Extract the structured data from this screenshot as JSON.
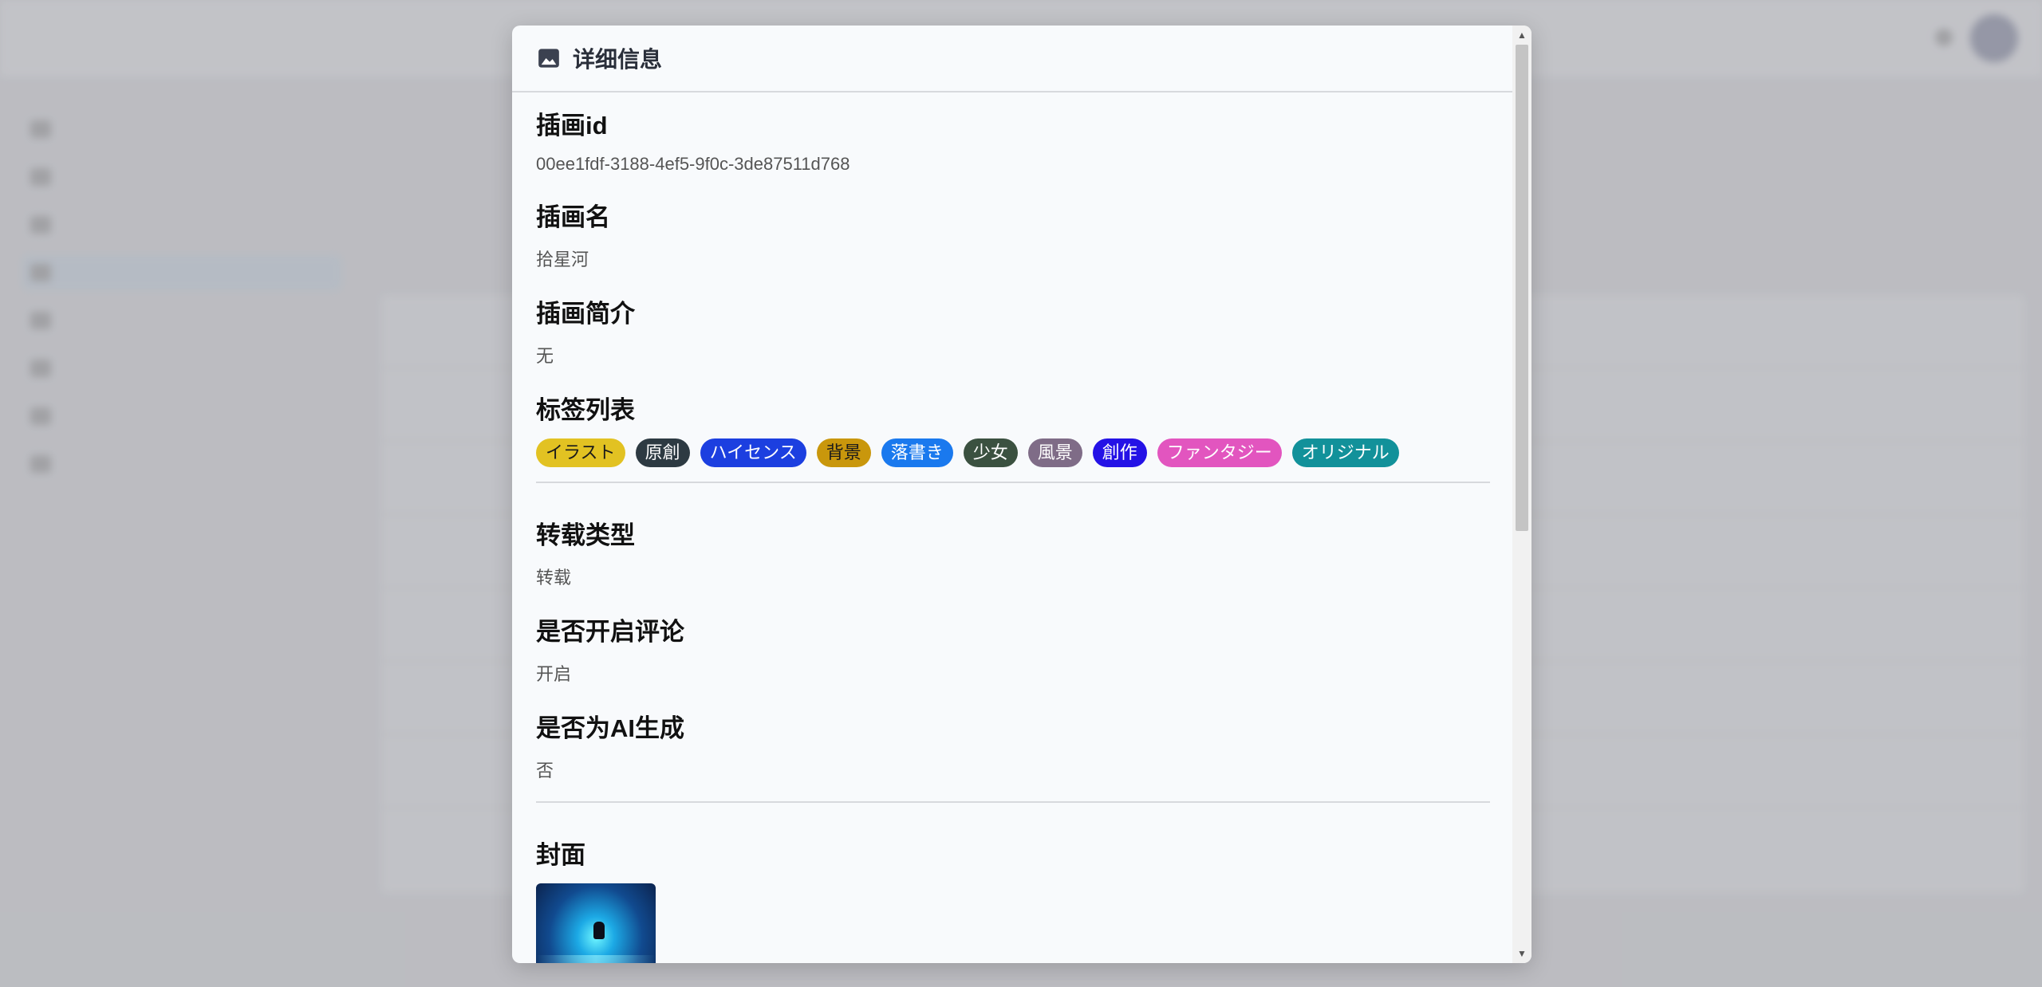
{
  "modal": {
    "title": "详细信息",
    "fields": {
      "id": {
        "label": "插画id",
        "value": "00ee1fdf-3188-4ef5-9f0c-3de87511d768"
      },
      "name": {
        "label": "插画名",
        "value": "拾星河"
      },
      "intro": {
        "label": "插画简介",
        "value": "无"
      },
      "tags": {
        "label": "标签列表"
      },
      "repost": {
        "label": "转载类型",
        "value": "转载"
      },
      "comment": {
        "label": "是否开启评论",
        "value": "开启"
      },
      "ai": {
        "label": "是否为AI生成",
        "value": "否"
      },
      "cover": {
        "label": "封面"
      }
    },
    "tags": [
      {
        "text": "イラスト",
        "bg": "#e2c222",
        "color": "#1b1b1b"
      },
      {
        "text": "原創",
        "bg": "#2d3a42",
        "color": "#ffffff"
      },
      {
        "text": "ハイセンス",
        "bg": "#1c3fe0",
        "color": "#ffffff"
      },
      {
        "text": "背景",
        "bg": "#c9970c",
        "color": "#1b1b1b"
      },
      {
        "text": "落書き",
        "bg": "#1a79ee",
        "color": "#ffffff"
      },
      {
        "text": "少女",
        "bg": "#3b5140",
        "color": "#ffffff"
      },
      {
        "text": "風景",
        "bg": "#7f6c87",
        "color": "#ffffff"
      },
      {
        "text": "創作",
        "bg": "#2412e6",
        "color": "#ffffff"
      },
      {
        "text": "ファンタジー",
        "bg": "#e255bf",
        "color": "#ffffff"
      },
      {
        "text": "オリジナル",
        "bg": "#12919a",
        "color": "#ffffff"
      }
    ]
  },
  "scrollbar": {
    "up": "▲",
    "down": "▼"
  }
}
